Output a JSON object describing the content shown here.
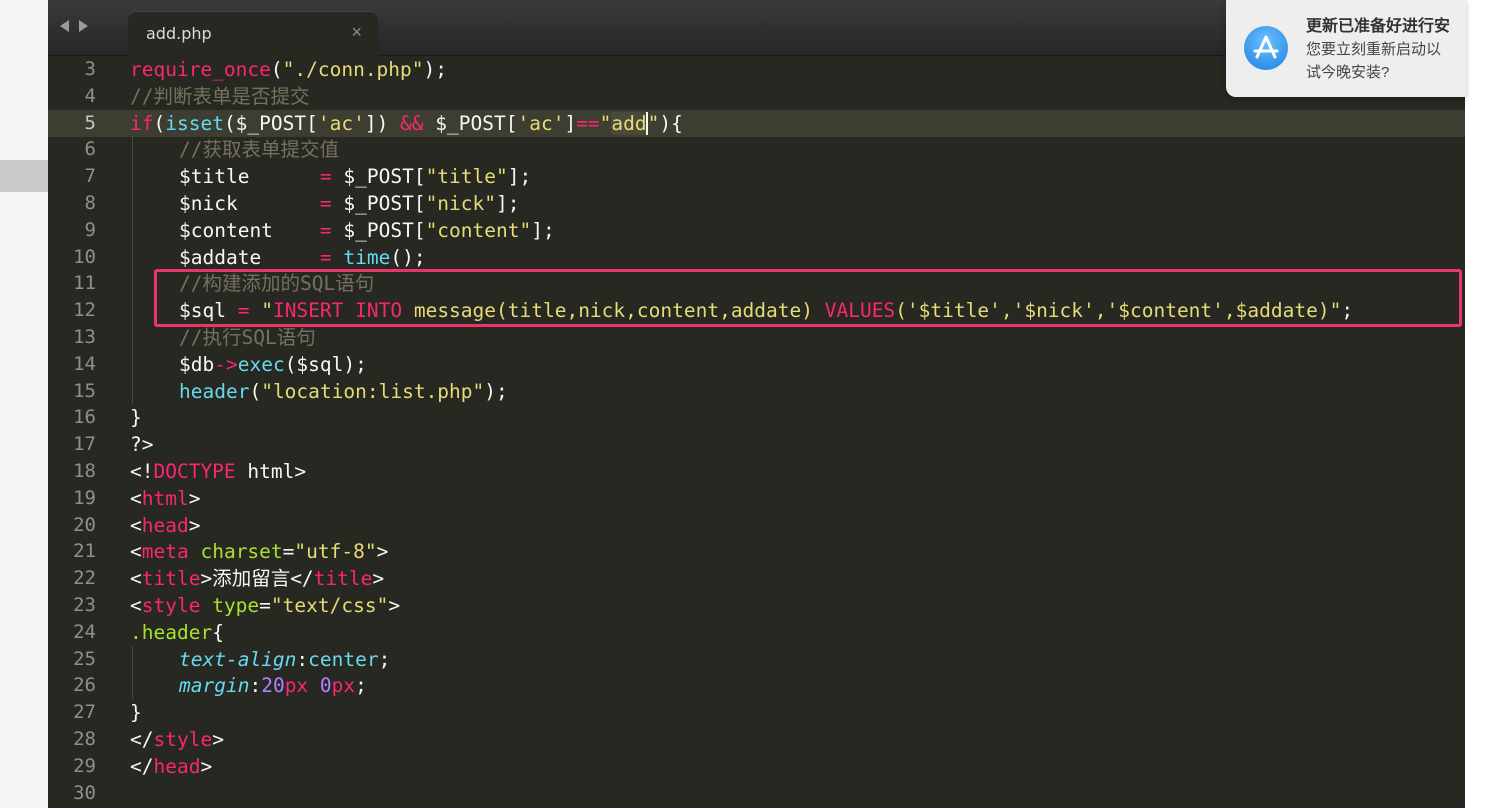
{
  "editor": {
    "tab": {
      "title": "add.php",
      "close_glyph": "×"
    },
    "nav": {
      "back_icon": "back-arrow-icon",
      "forward_icon": "forward-arrow-icon"
    },
    "current_line": 5,
    "highlighted_lines": [
      11,
      12
    ],
    "highlight_color": "#e8356d",
    "lines": [
      {
        "n": 3,
        "tokens": [
          [
            "require_once",
            "kw"
          ],
          [
            "(",
            "plain"
          ],
          [
            "\"./conn.php\"",
            "str"
          ],
          [
            ");",
            "plain"
          ]
        ]
      },
      {
        "n": 4,
        "tokens": [
          [
            "//判断表单是否提交",
            "cm"
          ]
        ]
      },
      {
        "n": 5,
        "tokens": [
          [
            "if",
            "kw"
          ],
          [
            "(",
            "plain"
          ],
          [
            "isset",
            "fn"
          ],
          [
            "($_POST[",
            "plain"
          ],
          [
            "'ac'",
            "str"
          ],
          [
            "]) ",
            "plain"
          ],
          [
            "&&",
            "kw"
          ],
          [
            " $_POST[",
            "plain"
          ],
          [
            "'ac'",
            "str"
          ],
          [
            "]",
            "plain"
          ],
          [
            "==",
            "kw"
          ],
          [
            "\"",
            "str"
          ],
          [
            "add",
            "hl"
          ],
          [
            "\"",
            "strcaret"
          ],
          [
            "){",
            "plain"
          ]
        ]
      },
      {
        "n": 6,
        "indent": 1,
        "tokens": [
          [
            "//获取表单提交值",
            "cm"
          ]
        ]
      },
      {
        "n": 7,
        "indent": 1,
        "tokens": [
          [
            "$title      ",
            "plain"
          ],
          [
            "=",
            "kw"
          ],
          [
            " $_POST[",
            "plain"
          ],
          [
            "\"title\"",
            "str"
          ],
          [
            "];",
            "plain"
          ]
        ]
      },
      {
        "n": 8,
        "indent": 1,
        "tokens": [
          [
            "$nick       ",
            "plain"
          ],
          [
            "=",
            "kw"
          ],
          [
            " $_POST[",
            "plain"
          ],
          [
            "\"nick\"",
            "str"
          ],
          [
            "];",
            "plain"
          ]
        ]
      },
      {
        "n": 9,
        "indent": 1,
        "tokens": [
          [
            "$content    ",
            "plain"
          ],
          [
            "=",
            "kw"
          ],
          [
            " $_POST[",
            "plain"
          ],
          [
            "\"content\"",
            "str"
          ],
          [
            "];",
            "plain"
          ]
        ]
      },
      {
        "n": 10,
        "indent": 1,
        "tokens": [
          [
            "$addate     ",
            "plain"
          ],
          [
            "=",
            "kw"
          ],
          [
            " ",
            "plain"
          ],
          [
            "time",
            "fn"
          ],
          [
            "();",
            "plain"
          ]
        ]
      },
      {
        "n": 11,
        "indent": 1,
        "tokens": [
          [
            "//构建添加的SQL语句",
            "cm"
          ]
        ]
      },
      {
        "n": 12,
        "indent": 1,
        "tokens": [
          [
            "$sql ",
            "plain"
          ],
          [
            "=",
            "kw"
          ],
          [
            " ",
            "plain"
          ],
          [
            "\"",
            "str"
          ],
          [
            "INSERT INTO",
            "kw"
          ],
          [
            " message(title,nick,content,addate) ",
            "str"
          ],
          [
            "VALUES",
            "kw"
          ],
          [
            "('$title','$nick','$content',$addate)\"",
            "str"
          ],
          [
            ";",
            "plain"
          ]
        ]
      },
      {
        "n": 13,
        "indent": 1,
        "tokens": [
          [
            "//执行SQL语句",
            "cm"
          ]
        ]
      },
      {
        "n": 14,
        "indent": 1,
        "tokens": [
          [
            "$db",
            "plain"
          ],
          [
            "->",
            "kw"
          ],
          [
            "exec",
            "fn"
          ],
          [
            "($sql);",
            "plain"
          ]
        ]
      },
      {
        "n": 15,
        "indent": 1,
        "tokens": [
          [
            "header",
            "fn"
          ],
          [
            "(",
            "plain"
          ],
          [
            "\"location:list.php\"",
            "str"
          ],
          [
            ");",
            "plain"
          ]
        ]
      },
      {
        "n": 16,
        "tokens": [
          [
            "}",
            "plain"
          ]
        ]
      },
      {
        "n": 17,
        "tokens": [
          [
            "?>",
            "plain"
          ]
        ]
      },
      {
        "n": 18,
        "tokens": [
          [
            "<!",
            "plain"
          ],
          [
            "DOCTYPE",
            "kw"
          ],
          [
            " html>",
            "plain"
          ]
        ]
      },
      {
        "n": 19,
        "tokens": [
          [
            "<",
            "plain"
          ],
          [
            "html",
            "kw"
          ],
          [
            ">",
            "plain"
          ]
        ]
      },
      {
        "n": 20,
        "tokens": [
          [
            "<",
            "plain"
          ],
          [
            "head",
            "kw"
          ],
          [
            ">",
            "plain"
          ]
        ]
      },
      {
        "n": 21,
        "tokens": [
          [
            "<",
            "plain"
          ],
          [
            "meta",
            "kw"
          ],
          [
            " ",
            "plain"
          ],
          [
            "charset",
            "attr"
          ],
          [
            "=",
            "plain"
          ],
          [
            "\"utf-8\"",
            "str"
          ],
          [
            ">",
            "plain"
          ]
        ]
      },
      {
        "n": 22,
        "tokens": [
          [
            "<",
            "plain"
          ],
          [
            "title",
            "kw"
          ],
          [
            ">添加留言</",
            "plain"
          ],
          [
            "title",
            "kw"
          ],
          [
            ">",
            "plain"
          ]
        ]
      },
      {
        "n": 23,
        "tokens": [
          [
            "<",
            "plain"
          ],
          [
            "style",
            "kw"
          ],
          [
            " ",
            "plain"
          ],
          [
            "type",
            "attr"
          ],
          [
            "=",
            "plain"
          ],
          [
            "\"text/css\"",
            "str"
          ],
          [
            ">",
            "plain"
          ]
        ]
      },
      {
        "n": 24,
        "tokens": [
          [
            ".header",
            "attr"
          ],
          [
            "{",
            "plain"
          ]
        ]
      },
      {
        "n": 25,
        "indent": 1,
        "tokens": [
          [
            "text-align",
            "it"
          ],
          [
            ":",
            "plain"
          ],
          [
            "center",
            "fn"
          ],
          [
            ";",
            "plain"
          ]
        ]
      },
      {
        "n": 26,
        "indent": 1,
        "tokens": [
          [
            "margin",
            "it"
          ],
          [
            ":",
            "plain"
          ],
          [
            "20",
            "num"
          ],
          [
            "px",
            "kw"
          ],
          [
            " ",
            "plain"
          ],
          [
            "0",
            "num"
          ],
          [
            "px",
            "kw"
          ],
          [
            ";",
            "plain"
          ]
        ]
      },
      {
        "n": 27,
        "tokens": [
          [
            "}",
            "plain"
          ]
        ]
      },
      {
        "n": 28,
        "tokens": [
          [
            "</",
            "plain"
          ],
          [
            "style",
            "kw"
          ],
          [
            ">",
            "plain"
          ]
        ]
      },
      {
        "n": 29,
        "tokens": [
          [
            "</",
            "plain"
          ],
          [
            "head",
            "kw"
          ],
          [
            ">",
            "plain"
          ]
        ]
      },
      {
        "n": 30,
        "tokens": []
      }
    ]
  },
  "notification": {
    "icon": "app-store-icon",
    "title": "更新已准备好进行安",
    "body_line1": "您要立刻重新启动以",
    "body_line2": "试今晚安装?"
  }
}
